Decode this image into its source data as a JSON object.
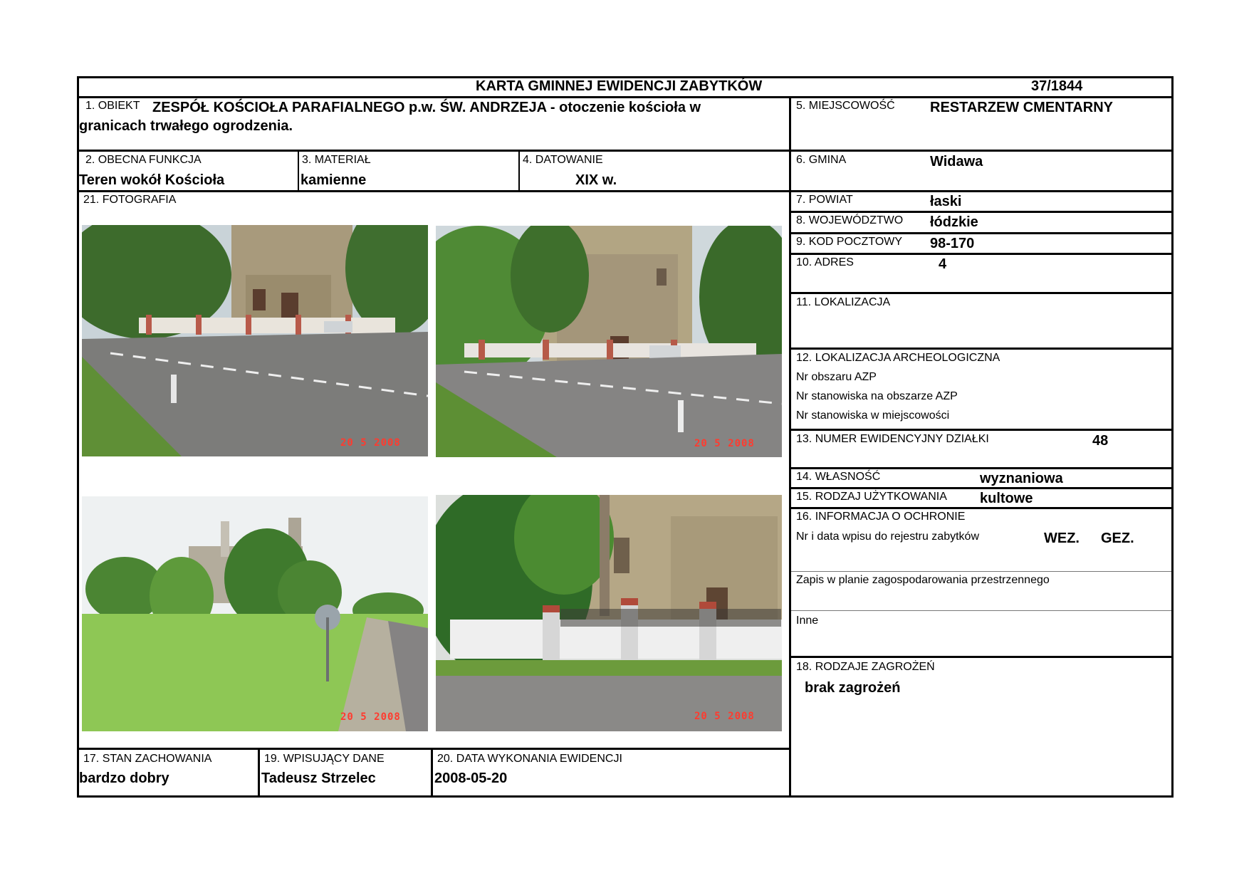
{
  "header": {
    "title": "KARTA GMINNEJ EWIDENCJI ZABYTKÓW",
    "number": "37/1844"
  },
  "obiekt": {
    "label": "1. OBIEKT",
    "line1": "ZESPÓŁ KOŚCIOŁA PARAFIALNEGO p.w. ŚW. ANDRZEJA - otoczenie kościoła w",
    "line2": "granicach trwałego ogrodzenia."
  },
  "funkcja": {
    "label": "2. OBECNA FUNKCJA",
    "value": "Teren wokół Kościoła"
  },
  "material": {
    "label": "3. MATERIAŁ",
    "value": "kamienne"
  },
  "datowanie": {
    "label": "4. DATOWANIE",
    "value": "XIX w."
  },
  "fotografia": {
    "label": "21. FOTOGRAFIA"
  },
  "photos": [
    {
      "stamp": "20 5 2008"
    },
    {
      "stamp": "20 5 2008"
    },
    {
      "stamp": "20 5 2008"
    },
    {
      "stamp": "20 5 2008"
    }
  ],
  "miejscowosc": {
    "label": "5. MIEJSCOWOŚĆ",
    "value": "RESTARZEW CMENTARNY"
  },
  "gmina": {
    "label": "6. GMINA",
    "value": "Widawa"
  },
  "powiat": {
    "label": "7. POWIAT",
    "value": "łaski"
  },
  "wojewodztwo": {
    "label": "8. WOJEWÓDZTWO",
    "value": "łódzkie"
  },
  "kod": {
    "label": "9. KOD POCZTOWY",
    "value": "98-170"
  },
  "adres": {
    "label": "10. ADRES",
    "value": "4"
  },
  "lokalizacja": {
    "label": "11. LOKALIZACJA"
  },
  "archeo": {
    "label": "12. LOKALIZACJA ARCHEOLOGICZNA",
    "line1": "Nr obszaru AZP",
    "line2": "Nr stanowiska na obszarze AZP",
    "line3": "Nr stanowiska w miejscowości"
  },
  "dzialka": {
    "label": "13. NUMER EWIDENCYJNY DZIAŁKI",
    "value": "48"
  },
  "wlasnosc": {
    "label": "14. WŁASNOŚĆ",
    "value": "wyznaniowa"
  },
  "uzytkowanie": {
    "label": "15. RODZAJ UŻYTKOWANIA",
    "value": "kultowe"
  },
  "ochrona": {
    "label": "16. INFORMACJA O OCHRONIE",
    "rejestr": "Nr i data wpisu do rejestru zabytków",
    "wez": "WEZ.",
    "gez": "GEZ.",
    "plan": "Zapis w planie zagospodarowania przestrzennego",
    "inne": "Inne"
  },
  "zagrozenia": {
    "label": "18. RODZAJE ZAGROŻEŃ",
    "value": "brak zagrożeń"
  },
  "stan": {
    "label": "17. STAN ZACHOWANIA",
    "value": "bardzo dobry"
  },
  "wpisujacy": {
    "label": "19. WPISUJĄCY DANE",
    "value": "Tadeusz Strzelec"
  },
  "data_ewid": {
    "label": "20. DATA WYKONANIA EWIDENCJI",
    "value": "2008-05-20"
  }
}
